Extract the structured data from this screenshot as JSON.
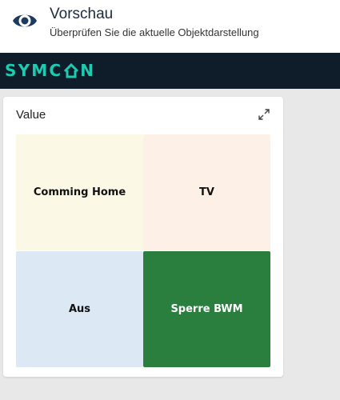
{
  "header": {
    "icon": "eye-icon",
    "title": "Vorschau",
    "subtitle": "Überprüfen Sie die aktuelle Objektdarstellung"
  },
  "brand": {
    "logo_text_left": "SYMC",
    "logo_text_right": "N",
    "logo_color": "#1ecbb0",
    "bar_color": "#0f1d2a"
  },
  "card": {
    "title": "Value",
    "expand_icon": "expand-icon",
    "tiles": [
      {
        "label": "Comming Home",
        "bg": "#fbf8e6",
        "fg": "#111111"
      },
      {
        "label": "TV",
        "bg": "#fdf0e6",
        "fg": "#111111"
      },
      {
        "label": "Aus",
        "bg": "#dde8f5",
        "fg": "#111111"
      },
      {
        "label": "Sperre BWM",
        "bg": "#2a7f3e",
        "fg": "#ffffff"
      }
    ]
  }
}
